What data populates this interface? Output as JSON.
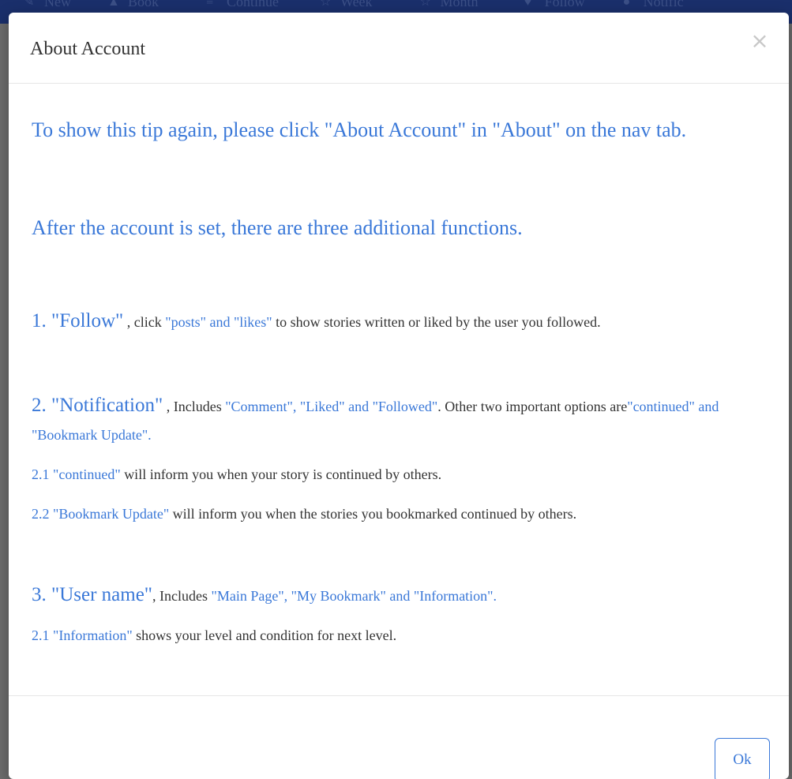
{
  "background": {
    "nav_items": [
      {
        "icon": "pencil-icon",
        "label": "New"
      },
      {
        "icon": "book-icon",
        "label": "Book"
      },
      {
        "icon": "list-icon",
        "label": "Continue"
      },
      {
        "icon": "star-icon",
        "label": "Week"
      },
      {
        "icon": "star-icon",
        "label": "Month"
      },
      {
        "icon": "heart-icon",
        "label": "Follow"
      },
      {
        "icon": "bell-icon",
        "label": "Notific"
      }
    ]
  },
  "modal": {
    "title": "About Account",
    "close_symbol": "×",
    "tip": "To show this tip again, please click \"About Account\" in \"About\" on the nav tab.",
    "intro": "After the account is set, there are three additional functions.",
    "follow": {
      "heading": "1. \"Follow\"",
      "pre": " , click ",
      "highlight": "\"posts\" and \"likes\"",
      "post": " to show stories written or liked by the user you followed."
    },
    "notification": {
      "heading": "2. \"Notification\"",
      "pre": " , Includes ",
      "highlight": "\"Comment\", \"Liked\" and \"Followed\"",
      "mid": ". Other two important options are",
      "highlight2": "\"continued\" and \"Bookmark Update\".",
      "sub1_highlight": "2.1 \"continued\"",
      "sub1_text": " will inform you when your story is continued by others.",
      "sub2_highlight": "2.2 \"Bookmark Update\"",
      "sub2_text": " will inform you when the stories you bookmarked continued by others."
    },
    "username": {
      "heading": "3. \"User name\"",
      "pre": ", Includes ",
      "highlight": "\"Main Page\", \"My Bookmark\" and \"Information\".",
      "sub1_highlight": "2.1 \"Information\"",
      "sub1_text": " shows your level and condition for next level."
    },
    "ok_label": "Ok"
  },
  "colors": {
    "accent": "#3a78d8",
    "text": "#333333",
    "navbar": "#1a2f6b",
    "overlay": "#6f6f6f"
  }
}
